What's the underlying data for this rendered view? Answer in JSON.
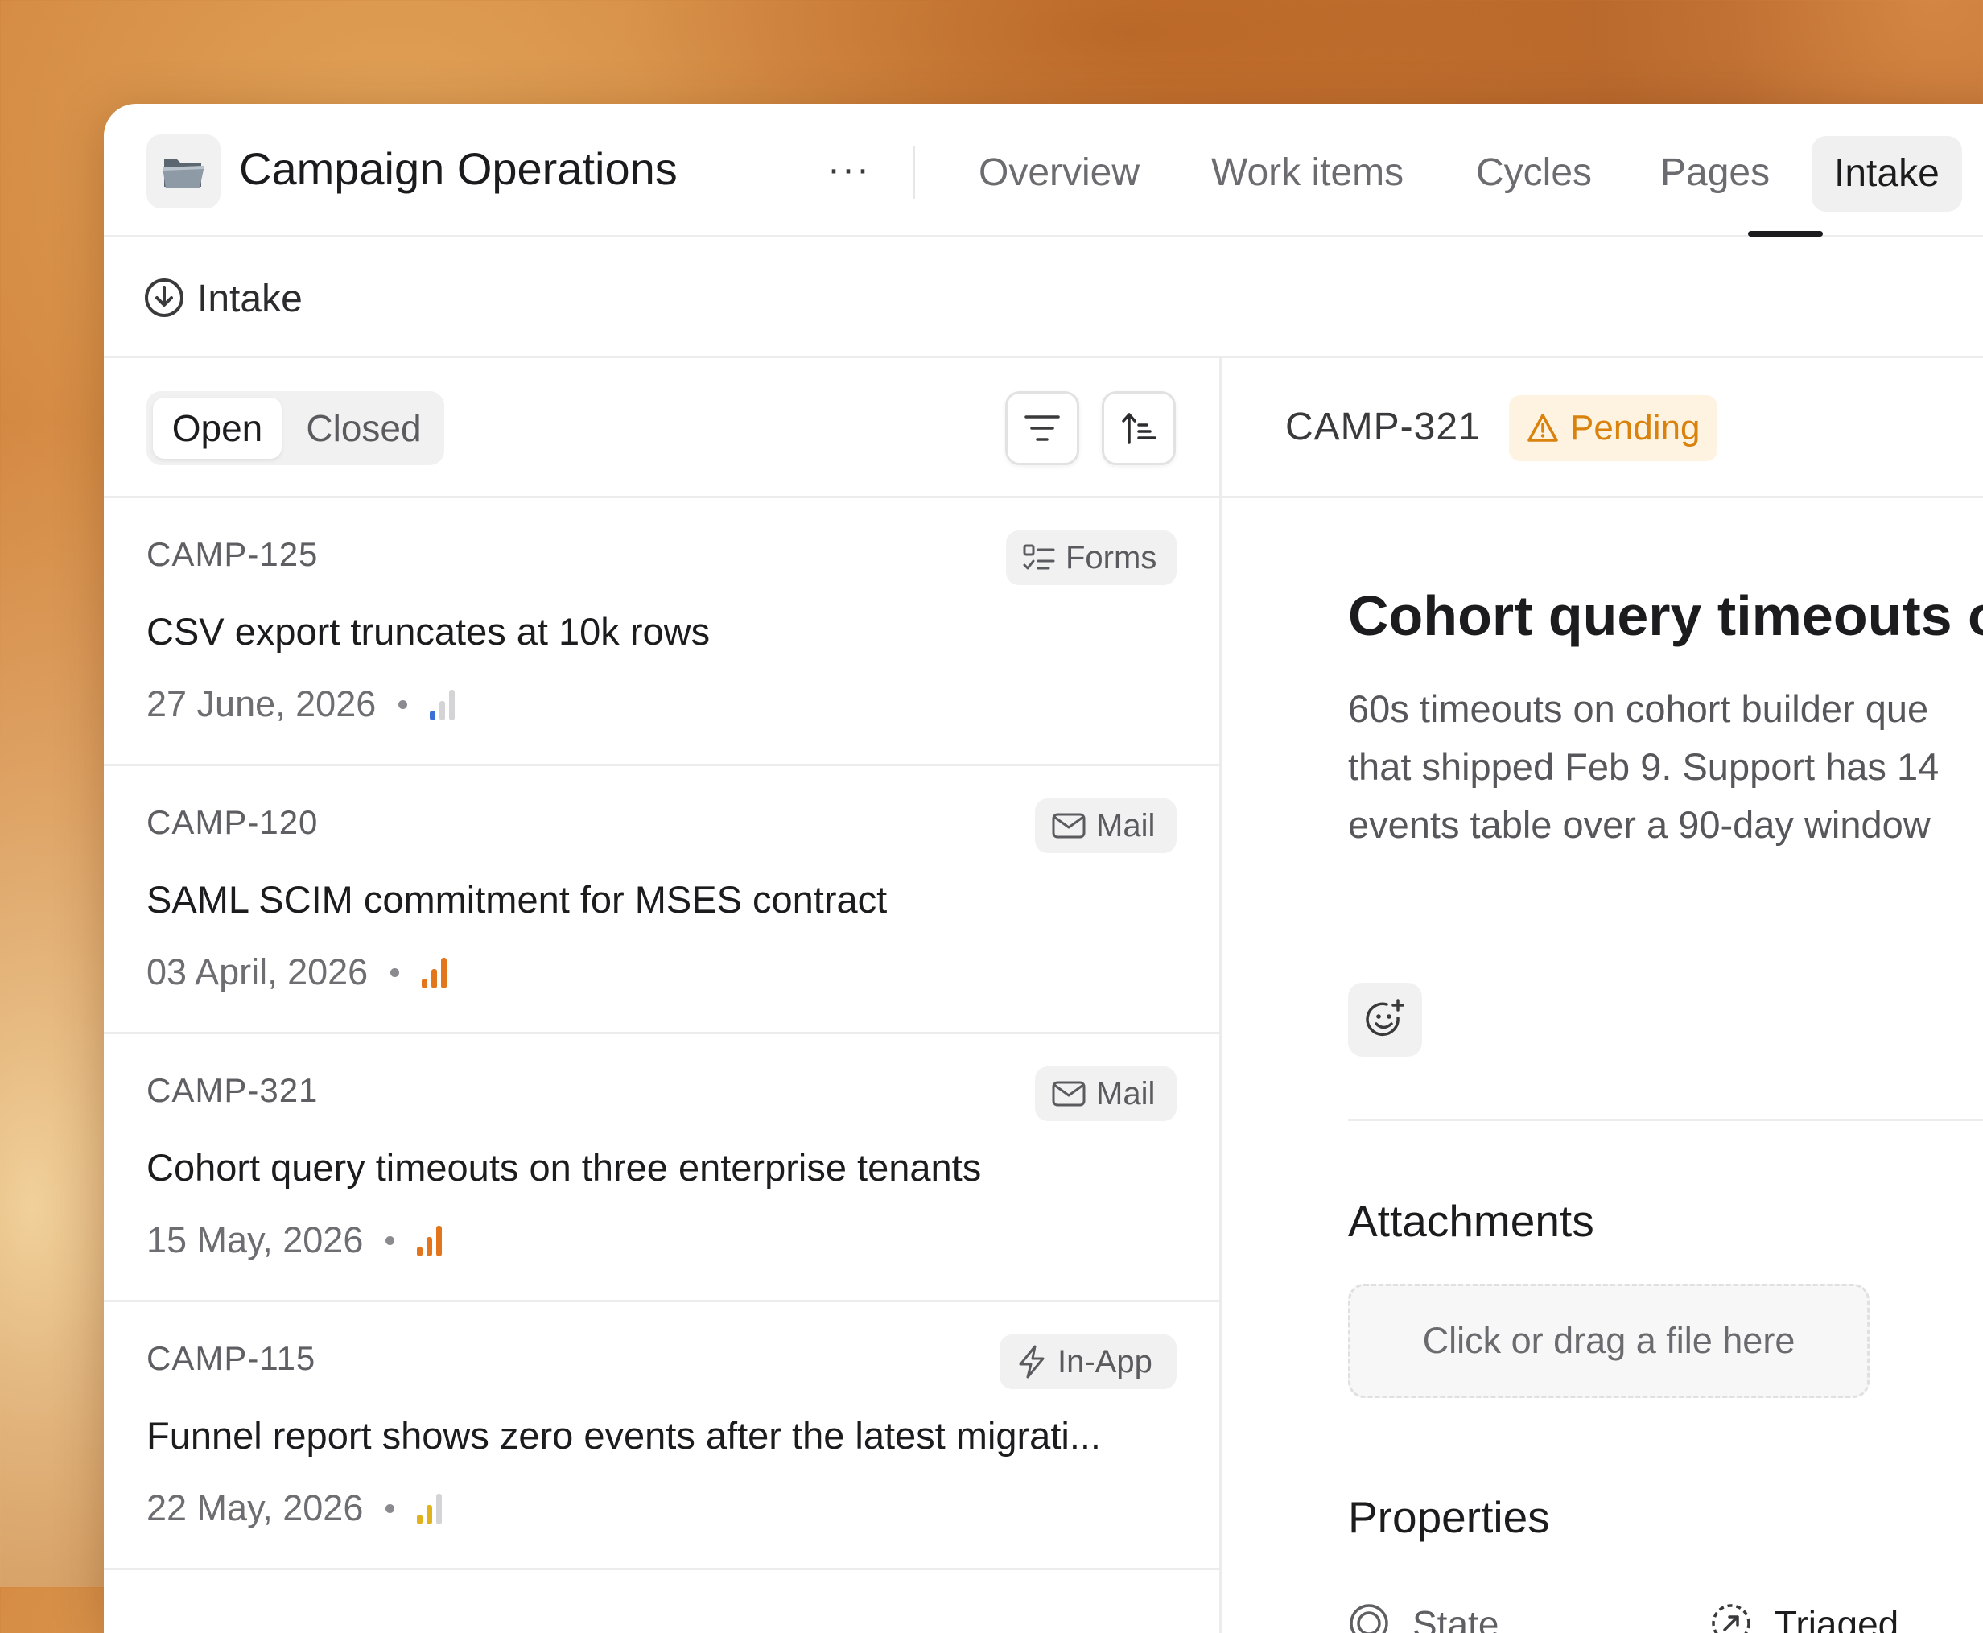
{
  "header": {
    "project_title": "Campaign Operations",
    "project_icon": "folder-icon",
    "more_label": "···",
    "tabs": [
      {
        "label": "Overview"
      },
      {
        "label": "Work items"
      },
      {
        "label": "Cycles"
      },
      {
        "label": "Pages"
      },
      {
        "label": "Intake",
        "active": true
      }
    ],
    "overflow_label": "···"
  },
  "breadcrumb": {
    "label": "Intake",
    "icon": "intake-download-icon"
  },
  "list": {
    "segment": {
      "open_label": "Open",
      "closed_label": "Closed",
      "selected": "Open"
    },
    "toolbar_icons": [
      "filter-icon",
      "sort-icon"
    ],
    "items": [
      {
        "id": "CAMP-125",
        "title": "CSV export truncates at 10k rows",
        "date": "27 June, 2026",
        "source": "Forms",
        "source_icon": "forms-icon",
        "priority": "low",
        "priority_color": "#3b6fd8"
      },
      {
        "id": "CAMP-120",
        "title": "SAML SCIM commitment for MSES contract",
        "date": "03 April, 2026",
        "source": "Mail",
        "source_icon": "mail-icon",
        "priority": "high",
        "priority_color": "#e3761c"
      },
      {
        "id": "CAMP-321",
        "title": "Cohort query timeouts on three enterprise tenants",
        "date": "15 May, 2026",
        "source": "Mail",
        "source_icon": "mail-icon",
        "priority": "high",
        "priority_color": "#e3761c"
      },
      {
        "id": "CAMP-115",
        "title": "Funnel report shows zero events after the latest migrati...",
        "date": "22 May, 2026",
        "source": "In-App",
        "source_icon": "lightning-icon",
        "priority": "medium",
        "priority_color": "#e0b21c"
      }
    ]
  },
  "detail": {
    "id": "CAMP-321",
    "status": "Pending",
    "status_color": "#d9820d",
    "title": "Cohort query timeouts o",
    "description_lines": [
      "60s timeouts on cohort builder que",
      "that shipped Feb 9. Support has 14",
      "events table over a 90-day window"
    ],
    "attachments_heading": "Attachments",
    "dropzone_text": "Click or drag a file here",
    "properties_heading": "Properties",
    "property": {
      "label": "State",
      "value": "Triaged"
    }
  }
}
